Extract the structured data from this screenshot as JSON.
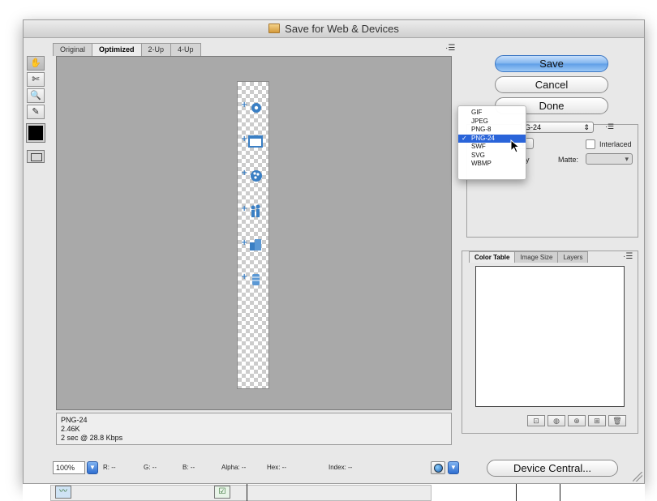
{
  "window": {
    "title": "Save for Web & Devices"
  },
  "tools": [
    {
      "name": "hand-tool",
      "glyph": "✋"
    },
    {
      "name": "slice-select-tool",
      "glyph": "✄"
    },
    {
      "name": "zoom-tool",
      "glyph": "🔍"
    },
    {
      "name": "eyedropper-tool",
      "glyph": "✎"
    }
  ],
  "tabs": [
    "Original",
    "Optimized",
    "2-Up",
    "4-Up"
  ],
  "active_tab": "Optimized",
  "panel_menu_glyph": "·☰",
  "info": {
    "format": "PNG-24",
    "size": "2.46K",
    "speed": "2 sec @ 28.8 Kbps"
  },
  "bottombar": {
    "zoom": "100%",
    "r": "R:   --",
    "g": "G:   --",
    "b": "B:   --",
    "alpha": "Alpha:  --",
    "hex": "Hex:        --",
    "index": "Index:   --"
  },
  "buttons": {
    "save": "Save",
    "cancel": "Cancel",
    "done": "Done",
    "device_central": "Device Central..."
  },
  "settings": {
    "preset_value": "G-24",
    "interlaced_label": "Interlaced",
    "matte_label": "Matte:",
    "partial_label": "y"
  },
  "format_menu": {
    "items": [
      "GIF",
      "JPEG",
      "PNG-8",
      "PNG-24",
      "SWF",
      "SVG",
      "WBMP"
    ],
    "selected": "PNG-24",
    "check_glyph": "✓"
  },
  "color_table_panel": {
    "tabs": [
      "Color Table",
      "Image Size",
      "Layers"
    ],
    "active_tab": "Color Table",
    "buttons": [
      "⊡",
      "◍",
      "⊕",
      "⊞",
      "🗑"
    ]
  },
  "colors": {
    "accent_blue": "#2a64d9",
    "icon_blue": "#3a7fc4",
    "canvas_gray": "#a9a9a9"
  }
}
